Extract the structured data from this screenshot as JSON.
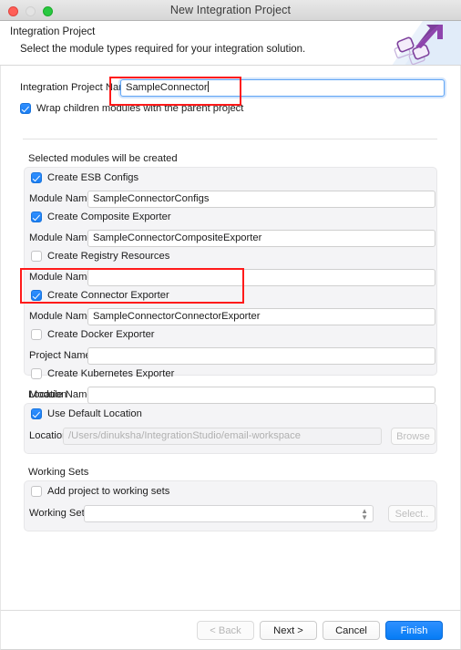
{
  "window": {
    "title": "New Integration Project",
    "traffic_lights": [
      "close-red",
      "minimize-gray",
      "zoom-green"
    ]
  },
  "header": {
    "title": "Integration Project",
    "subtitle": "Select the module types required for your integration solution.",
    "banner_icon": "integration-arrow-icon"
  },
  "project": {
    "name_label": "Integration Project Name",
    "name_value": "SampleConnector",
    "wrap_label": "Wrap children modules with the parent project",
    "wrap_checked": true
  },
  "modules": {
    "section_label": "Selected modules will be created",
    "items": [
      {
        "checkbox_label": "Create ESB Configs",
        "checked": true,
        "field_label": "Module Name",
        "field_value": "SampleConnectorConfigs"
      },
      {
        "checkbox_label": "Create Composite Exporter",
        "checked": true,
        "field_label": "Module Name",
        "field_value": "SampleConnectorCompositeExporter"
      },
      {
        "checkbox_label": "Create Registry Resources",
        "checked": false,
        "field_label": "Module Name",
        "field_value": ""
      },
      {
        "checkbox_label": "Create Connector Exporter",
        "checked": true,
        "field_label": "Module Name",
        "field_value": "SampleConnectorConnectorExporter"
      },
      {
        "checkbox_label": "Create Docker Exporter",
        "checked": false,
        "field_label": "Project Name",
        "field_value": ""
      },
      {
        "checkbox_label": "Create Kubernetes Exporter",
        "checked": false,
        "field_label": "Module Name",
        "field_value": ""
      }
    ]
  },
  "location": {
    "section_label": "Location",
    "use_default_label": "Use Default Location",
    "use_default_checked": true,
    "field_label": "Location",
    "field_value": "/Users/dinuksha/IntegrationStudio/email-workspace",
    "browse_label": "Browse"
  },
  "working_sets": {
    "section_label": "Working Sets",
    "add_label": "Add project to working sets",
    "add_checked": false,
    "field_label": "Working Sets",
    "field_value": "",
    "select_label": "Select.."
  },
  "footer": {
    "back_label": "< Back",
    "next_label": "Next >",
    "cancel_label": "Cancel",
    "finish_label": "Finish"
  },
  "colors": {
    "accent_blue": "#0a7cf5",
    "checkbox_blue": "#1a7ef2",
    "annotation_red": "#ff1a1a",
    "groupbox_bg": "#f4f4f6"
  }
}
